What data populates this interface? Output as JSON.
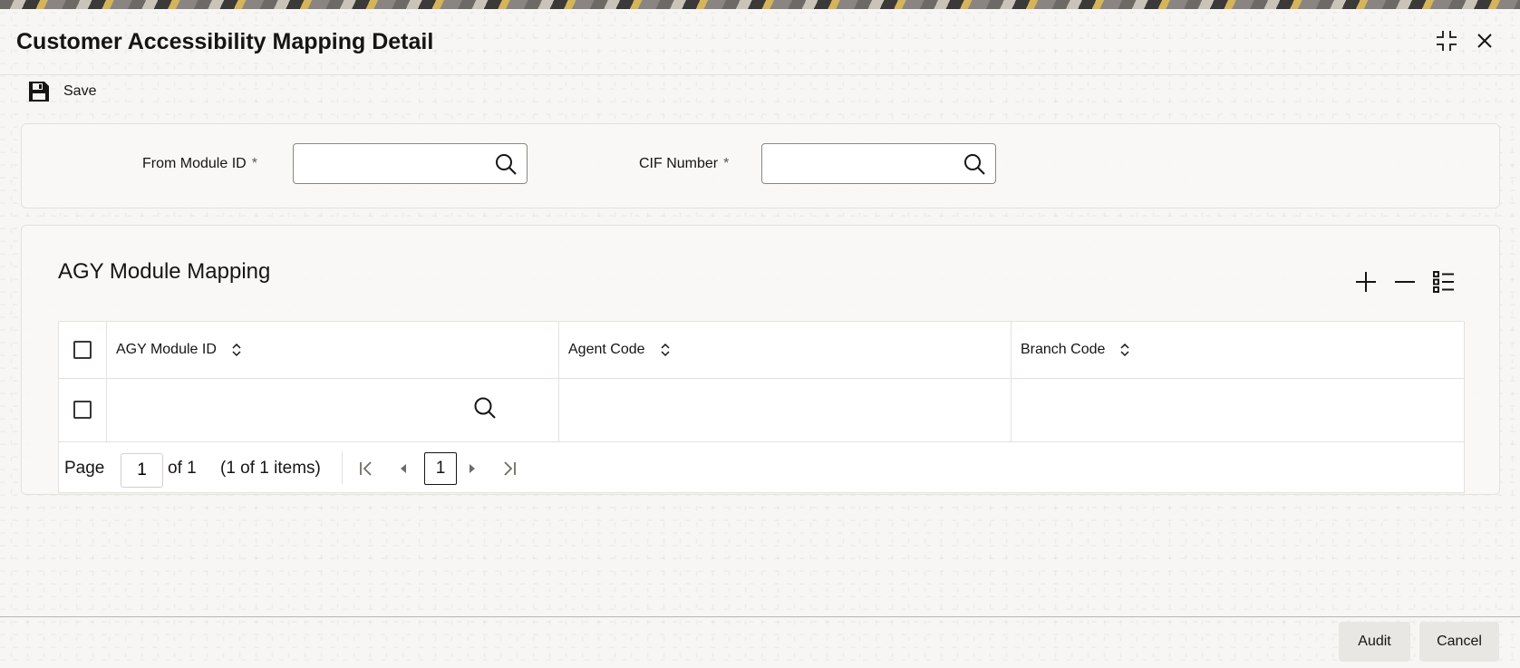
{
  "window": {
    "title": "Customer Accessibility Mapping Detail"
  },
  "toolbar": {
    "save_label": "Save"
  },
  "form": {
    "from_module_id": {
      "label": "From Module ID",
      "required": "*",
      "value": ""
    },
    "cif_number": {
      "label": "CIF Number",
      "required": "*",
      "value": ""
    }
  },
  "section": {
    "title": "AGY Module Mapping"
  },
  "table": {
    "columns": [
      "AGY Module ID",
      "Agent Code",
      "Branch Code"
    ],
    "rows": [
      {
        "agy_module_id": "",
        "agent_code": "",
        "branch_code": ""
      }
    ]
  },
  "pagination": {
    "page_label": "Page",
    "current_page": "1",
    "of_text": "of 1",
    "items_text": "(1 of 1 items)",
    "page_button": "1"
  },
  "footer": {
    "audit_label": "Audit",
    "cancel_label": "Cancel"
  },
  "icons": {
    "minimize": "minimize-icon",
    "close": "close-icon",
    "save": "save-icon",
    "search": "search-icon",
    "add": "plus-icon",
    "remove": "minus-icon",
    "list": "list-icon",
    "sort": "sort-icon",
    "first": "first-page-icon",
    "prev": "prev-page-icon",
    "next": "next-page-icon",
    "last": "last-page-icon"
  }
}
